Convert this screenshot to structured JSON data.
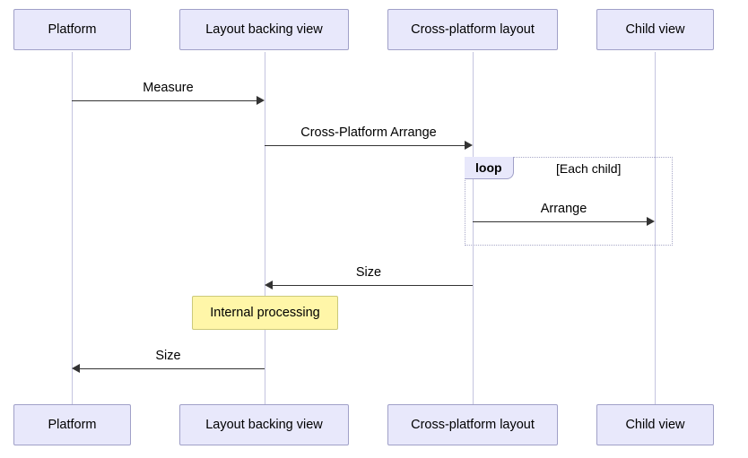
{
  "participants": {
    "p1": "Platform",
    "p2": "Layout backing view",
    "p3": "Cross-platform layout",
    "p4": "Child view"
  },
  "messages": {
    "m1": "Measure",
    "m2": "Cross-Platform Arrange",
    "m3": "Arrange",
    "m4": "Size",
    "m5": "Size"
  },
  "loop": {
    "tag": "loop",
    "condition": "[Each child]"
  },
  "note": {
    "text": "Internal processing"
  }
}
